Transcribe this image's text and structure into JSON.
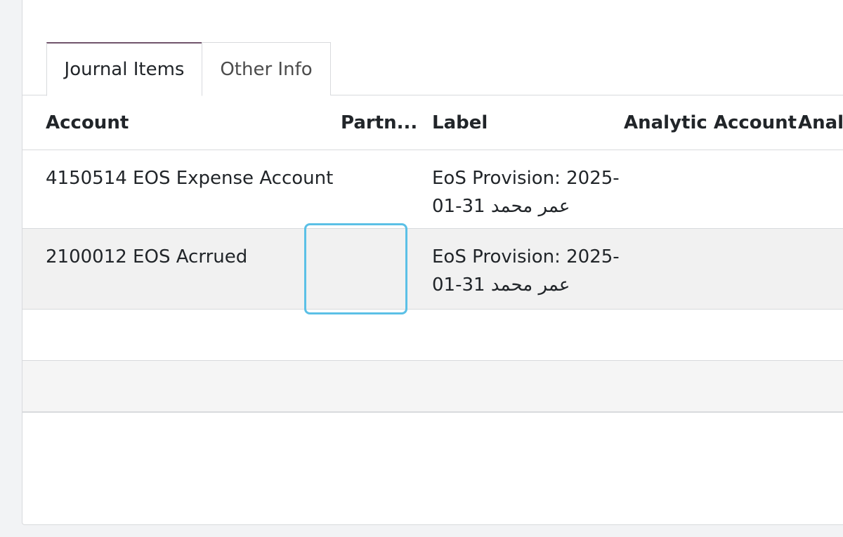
{
  "tabs": {
    "journal_items": "Journal Items",
    "other_info": "Other Info"
  },
  "table": {
    "headers": {
      "account": "Account",
      "partner": "Partn...",
      "label": "Label",
      "analytic_account": "Analytic Account",
      "analytic2": "Analytic"
    },
    "rows": [
      {
        "account": "4150514 EOS Expense Account",
        "partner": "",
        "label_line1": "EoS Provision: 2025-",
        "label_line2": "01-31 عمر محمد"
      },
      {
        "account": "2100012 EOS Acrrued",
        "partner": "",
        "label_line1": "EoS Provision: 2025-",
        "label_line2": "01-31 عمر محمد"
      }
    ]
  },
  "colors": {
    "accent": "#71546b",
    "focus": "#5bc0e6",
    "row_alt": "#f1f1f1"
  }
}
